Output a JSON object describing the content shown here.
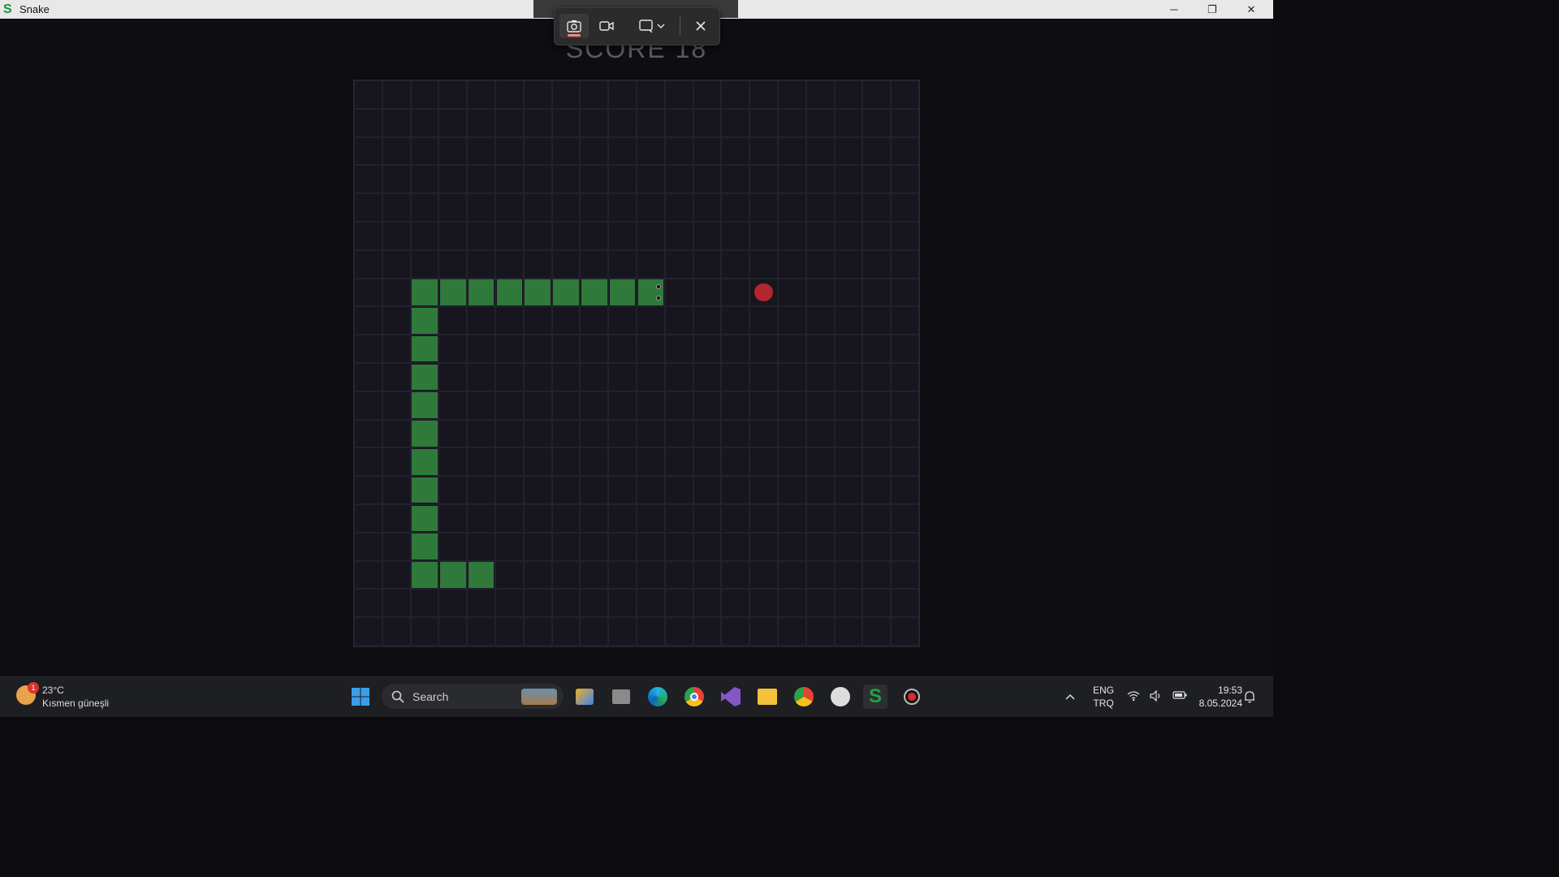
{
  "window": {
    "title": "Snake",
    "app_icon_letter": "S",
    "minimize_glyph": "─",
    "restore_glyph": "❐",
    "close_glyph": "✕"
  },
  "game": {
    "score_text": "SCORE  18",
    "grid": {
      "cols": 20,
      "rows": 20
    },
    "snake": {
      "head": [
        10,
        7
      ],
      "direction": "right",
      "body": [
        [
          9,
          7
        ],
        [
          8,
          7
        ],
        [
          7,
          7
        ],
        [
          6,
          7
        ],
        [
          5,
          7
        ],
        [
          4,
          7
        ],
        [
          3,
          7
        ],
        [
          2,
          7
        ],
        [
          2,
          8
        ],
        [
          2,
          9
        ],
        [
          2,
          10
        ],
        [
          2,
          11
        ],
        [
          2,
          12
        ],
        [
          2,
          13
        ],
        [
          2,
          14
        ],
        [
          2,
          15
        ],
        [
          2,
          16
        ],
        [
          2,
          17
        ],
        [
          3,
          17
        ],
        [
          4,
          17
        ]
      ]
    },
    "food": [
      14,
      7
    ],
    "colors": {
      "snake": "#2f7a3a",
      "food": "#b3262b",
      "board": "#17161f",
      "grid_line": "#22212d",
      "background": "#0d0d12"
    }
  },
  "snipping_toolbar": {
    "buttons": [
      {
        "icon": "camera-icon",
        "active": true
      },
      {
        "icon": "video-camera-icon",
        "active": false
      },
      {
        "icon": "capture-mode-icon",
        "has_dropdown": true
      },
      {
        "icon": "close-icon"
      }
    ]
  },
  "taskbar": {
    "weather": {
      "temperature": "23°C",
      "condition": "Kısmen güneşli",
      "badge": "1"
    },
    "search_placeholder": "Search",
    "apps": [
      "windows-start-icon",
      "task-view-icon",
      "files-icon",
      "edge-icon",
      "chrome-icon",
      "visual-studio-icon",
      "file-explorer-icon",
      "chrome-profile-icon",
      "github-icon",
      "snake-app-icon",
      "record-icon"
    ],
    "language": {
      "line1": "ENG",
      "line2": "TRQ"
    },
    "clock": {
      "time": "19:53",
      "date": "8.05.2024"
    }
  }
}
